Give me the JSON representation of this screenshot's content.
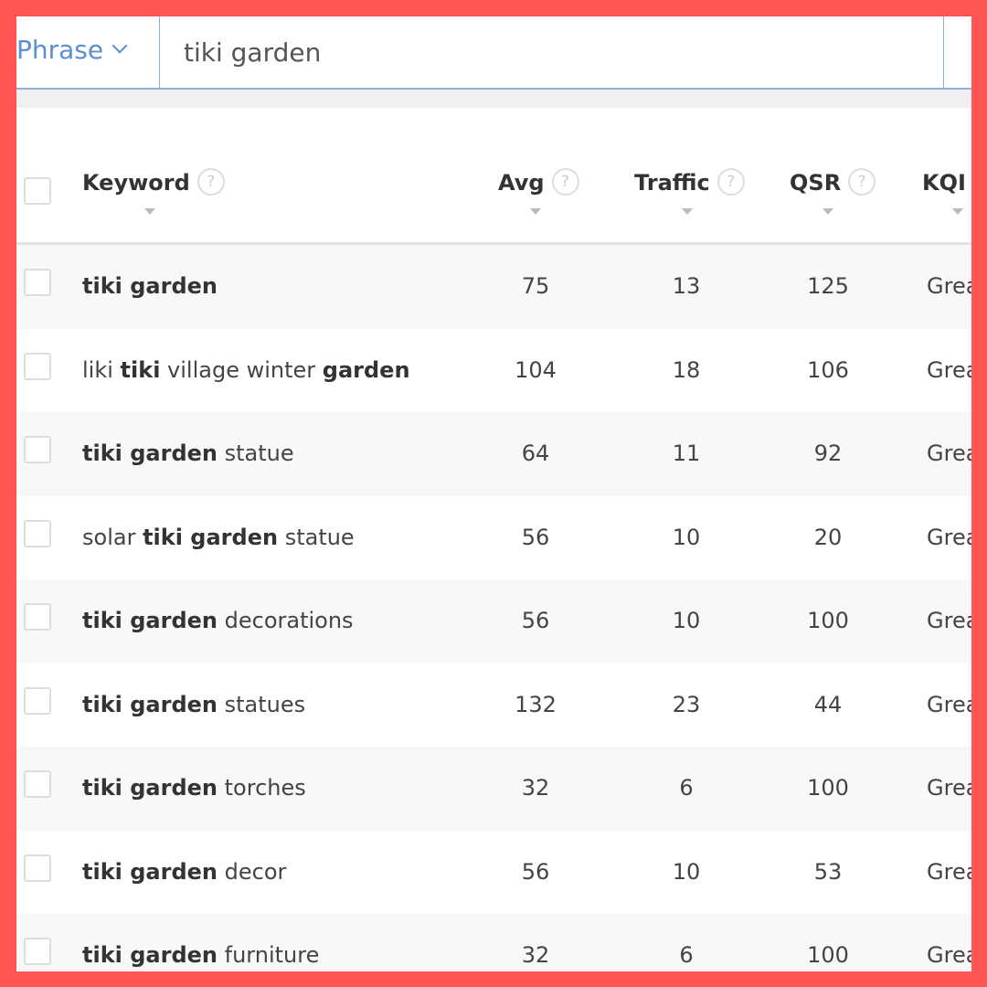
{
  "search": {
    "mode": "Phrase",
    "query": "tiki garden"
  },
  "colors": {
    "border": "#ff5555",
    "accent": "#5b8fd1",
    "kqi_great": "#6db56d"
  },
  "columns": [
    {
      "label": "Keyword",
      "help": "?"
    },
    {
      "label": "Avg",
      "help": "?"
    },
    {
      "label": "Traffic",
      "help": "?"
    },
    {
      "label": "QSR",
      "help": "?"
    },
    {
      "label": "KQI"
    }
  ],
  "rows": [
    {
      "keyword": [
        {
          "t": "tiki garden",
          "b": true
        }
      ],
      "avg": "75",
      "traffic": "13",
      "qsr": "125",
      "kqi": "Great"
    },
    {
      "keyword": [
        {
          "t": "liki ",
          "b": false
        },
        {
          "t": "tiki",
          "b": true
        },
        {
          "t": " village winter ",
          "b": false
        },
        {
          "t": "garden",
          "b": true
        }
      ],
      "avg": "104",
      "traffic": "18",
      "qsr": "106",
      "kqi": "Great"
    },
    {
      "keyword": [
        {
          "t": "tiki garden",
          "b": true
        },
        {
          "t": " statue",
          "b": false
        }
      ],
      "avg": "64",
      "traffic": "11",
      "qsr": "92",
      "kqi": "Great"
    },
    {
      "keyword": [
        {
          "t": "solar ",
          "b": false
        },
        {
          "t": "tiki garden",
          "b": true
        },
        {
          "t": " statue",
          "b": false
        }
      ],
      "avg": "56",
      "traffic": "10",
      "qsr": "20",
      "kqi": "Great"
    },
    {
      "keyword": [
        {
          "t": "tiki garden",
          "b": true
        },
        {
          "t": " decorations",
          "b": false
        }
      ],
      "avg": "56",
      "traffic": "10",
      "qsr": "100",
      "kqi": "Great"
    },
    {
      "keyword": [
        {
          "t": "tiki garden",
          "b": true
        },
        {
          "t": " statues",
          "b": false
        }
      ],
      "avg": "132",
      "traffic": "23",
      "qsr": "44",
      "kqi": "Great"
    },
    {
      "keyword": [
        {
          "t": "tiki garden",
          "b": true
        },
        {
          "t": " torches",
          "b": false
        }
      ],
      "avg": "32",
      "traffic": "6",
      "qsr": "100",
      "kqi": "Great"
    },
    {
      "keyword": [
        {
          "t": "tiki garden",
          "b": true
        },
        {
          "t": " decor",
          "b": false
        }
      ],
      "avg": "56",
      "traffic": "10",
      "qsr": "53",
      "kqi": "Great"
    },
    {
      "keyword": [
        {
          "t": "tiki garden",
          "b": true
        },
        {
          "t": " furniture",
          "b": false
        }
      ],
      "avg": "32",
      "traffic": "6",
      "qsr": "100",
      "kqi": "Great"
    }
  ]
}
